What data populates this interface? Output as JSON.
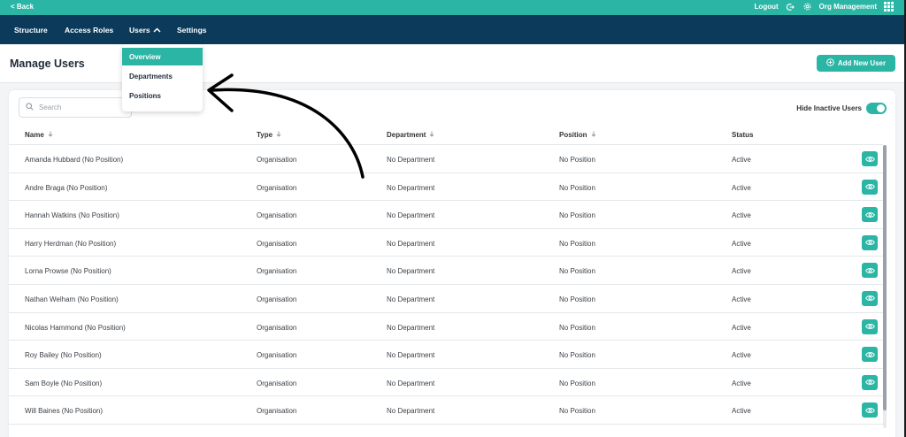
{
  "topbar": {
    "back_label": "< Back",
    "logout_label": "Logout",
    "org_label": "Org Management",
    "icons": [
      "logout-icon",
      "gear-icon",
      "grid-icon"
    ]
  },
  "nav": {
    "items": [
      {
        "label": "Structure"
      },
      {
        "label": "Access Roles"
      },
      {
        "label": "Users",
        "expanded": true
      },
      {
        "label": "Settings"
      }
    ]
  },
  "users_menu": {
    "items": [
      {
        "label": "Overview",
        "active": true
      },
      {
        "label": "Departments"
      },
      {
        "label": "Positions"
      }
    ]
  },
  "header": {
    "title": "Manage Users",
    "add_button_label": "Add New User"
  },
  "search": {
    "placeholder": "Search",
    "value": ""
  },
  "filter": {
    "hide_inactive_label": "Hide Inactive Users",
    "hide_inactive_on": true
  },
  "table": {
    "columns": [
      "Name",
      "Type",
      "Department",
      "Position",
      "Status"
    ],
    "rows": [
      {
        "name": "Amanda Hubbard (No Position)",
        "type": "Organisation",
        "department": "No Department",
        "position": "No Position",
        "status": "Active"
      },
      {
        "name": "Andre Braga (No Position)",
        "type": "Organisation",
        "department": "No Department",
        "position": "No Position",
        "status": "Active"
      },
      {
        "name": "Hannah Watkins (No Position)",
        "type": "Organisation",
        "department": "No Department",
        "position": "No Position",
        "status": "Active"
      },
      {
        "name": "Harry Herdman (No Position)",
        "type": "Organisation",
        "department": "No Department",
        "position": "No Position",
        "status": "Active"
      },
      {
        "name": "Lorna Prowse (No Position)",
        "type": "Organisation",
        "department": "No Department",
        "position": "No Position",
        "status": "Active"
      },
      {
        "name": "Nathan Welham (No Position)",
        "type": "Organisation",
        "department": "No Department",
        "position": "No Position",
        "status": "Active"
      },
      {
        "name": "Nicolas Hammond (No Position)",
        "type": "Organisation",
        "department": "No Department",
        "position": "No Position",
        "status": "Active"
      },
      {
        "name": "Roy Bailey (No Position)",
        "type": "Organisation",
        "department": "No Department",
        "position": "No Position",
        "status": "Active"
      },
      {
        "name": "Sam Boyle (No Position)",
        "type": "Organisation",
        "department": "No Department",
        "position": "No Position",
        "status": "Active"
      },
      {
        "name": "Will Baines (No Position)",
        "type": "Organisation",
        "department": "No Department",
        "position": "No Position",
        "status": "Active"
      }
    ]
  },
  "colors": {
    "accent": "#2bb5a5",
    "navbar": "#0b3a5b",
    "background": "#f3f4f6"
  }
}
